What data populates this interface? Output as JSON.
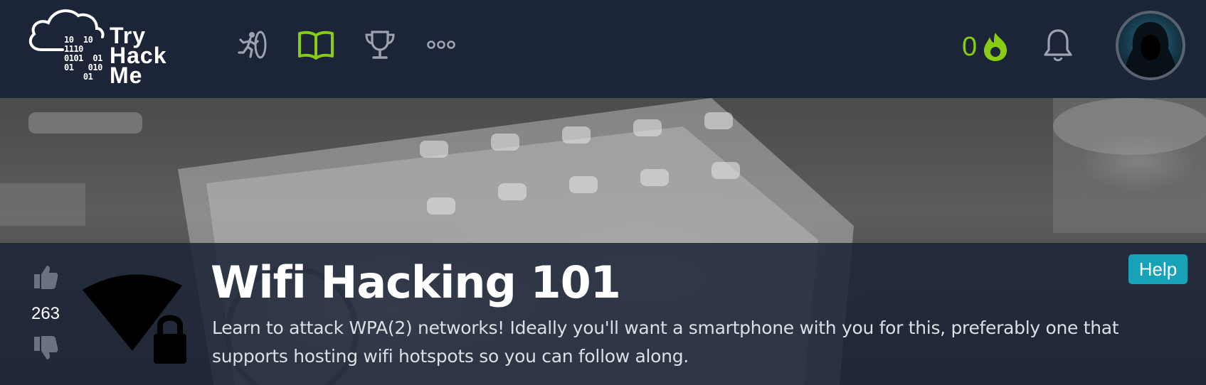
{
  "brand": {
    "logo_lines": [
      "Try",
      "Hack",
      "Me"
    ],
    "logo_bits": "10  10\n1110\n0101  01\n01   010\n    01"
  },
  "nav": {
    "icons": [
      "runner-icon",
      "book-icon",
      "trophy-icon",
      "more-icon"
    ],
    "active_icon": "book-icon",
    "active_color": "#88cc14",
    "inactive_color": "#9ca3af"
  },
  "streak": {
    "count": "0",
    "icon": "flame-icon",
    "color": "#88cc14"
  },
  "notifications": {
    "icon": "bell-icon"
  },
  "room": {
    "votes": "263",
    "title": "Wifi Hacking 101",
    "description": "Learn to attack WPA(2) networks! Ideally you'll want a smartphone with you for this, preferably one that supports hosting wifi hotspots so you can follow along.",
    "icon": "wifi-lock-icon",
    "help_label": "Help",
    "help_color": "#17a2b8"
  },
  "colors": {
    "navbar": "#1c2538",
    "overlay": "#1c2538"
  }
}
